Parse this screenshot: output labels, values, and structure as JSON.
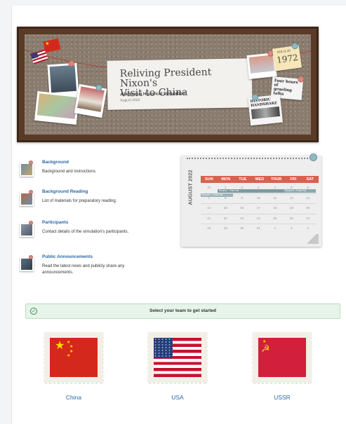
{
  "banner": {
    "title_line1": "Reliving President Nixon's",
    "title_line2": "Visit to China",
    "subtitle": "A Wikistrat Historical Simulation",
    "date": "August 2022",
    "note_small": "FEB 21-28",
    "note_year": "1972",
    "news1_line1": "Four hours of",
    "news1_line2": "grueling talks",
    "news2_line1": "HISTORIC",
    "news2_line2": "HANDSHAKE"
  },
  "sections": [
    {
      "title": "Background",
      "description": "Background and instructions.",
      "icon": "map-photo-icon"
    },
    {
      "title": "Background Reading",
      "description": "List of materials for preparatory reading.",
      "icon": "reading-photo-icon"
    },
    {
      "title": "Participants",
      "description": "Contact details of the simulation's participants.",
      "icon": "participants-photo-icon"
    },
    {
      "title": "Public Announcements",
      "description": "Read the latest news and publicly share any announcements.",
      "icon": "announcements-photo-icon"
    }
  ],
  "calendar": {
    "month_label": "AUGUST 2022",
    "days": [
      "SUN",
      "MON",
      "TUE",
      "WED",
      "THUR",
      "FRI",
      "SAT"
    ],
    "rows": [
      [
        "31",
        "1",
        "2",
        "3",
        "4",
        "5",
        "6"
      ],
      [
        "7",
        "8",
        "9",
        "10",
        "11",
        "12",
        "13"
      ],
      [
        "14",
        "15",
        "16",
        "17",
        "18",
        "19",
        "20"
      ],
      [
        "21",
        "22",
        "23",
        "24",
        "25",
        "26",
        "27"
      ],
      [
        "28",
        "29",
        "30",
        "31",
        "1",
        "2",
        "3"
      ]
    ],
    "event1": "Round I - The Pull",
    "event2": "Round II - Post Pull",
    "event3": "Round I - Post Pull"
  },
  "alert": {
    "message": "Select your team to get started",
    "icon": "check-circle-icon"
  },
  "teams": [
    {
      "name": "China",
      "flag": "china-flag-icon"
    },
    {
      "name": "USA",
      "flag": "usa-flag-icon"
    },
    {
      "name": "USSR",
      "flag": "ussr-flag-icon"
    }
  ],
  "colors": {
    "accent_link": "#2b66a8",
    "calendar_header": "#d7624e",
    "alert_bg": "#e6f4ea",
    "alert_border": "#b9dfc4",
    "frame": "#5a3b28",
    "china_red": "#d5281c",
    "ussr_red": "#d21f3c"
  }
}
